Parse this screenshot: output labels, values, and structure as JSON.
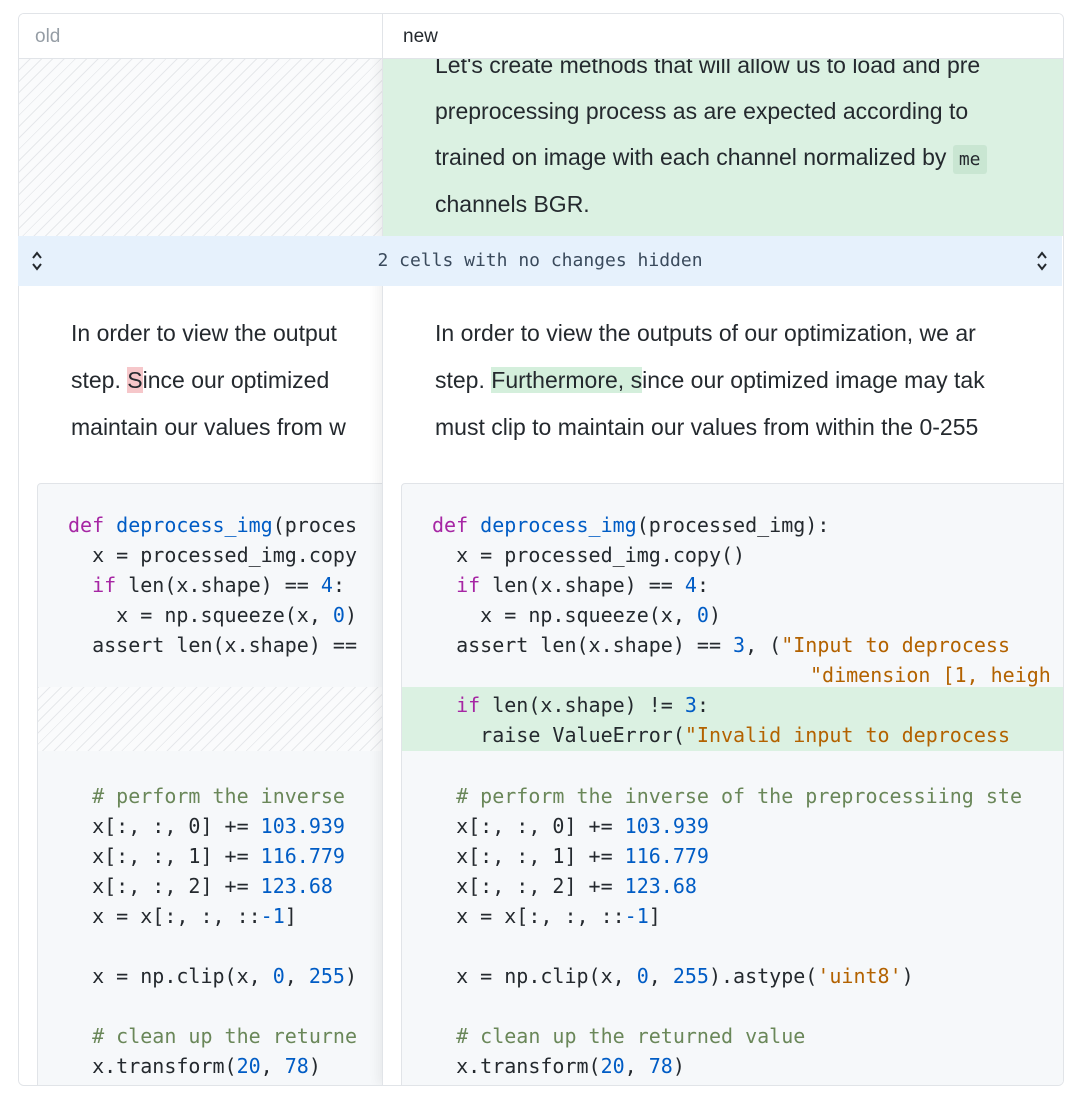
{
  "header": {
    "old_label": "old",
    "new_label": "new"
  },
  "new_markdown": {
    "line1": "Let's create methods that will allow us to load and pre",
    "line2": "preprocessing process as are expected according to",
    "line3_pre": "trained on image with each channel normalized by",
    "line3_code": "me",
    "line4": "channels BGR."
  },
  "hidden_band": {
    "text": "2 cells with no changes hidden",
    "icon": "unfold-icon"
  },
  "old_para": {
    "l1": "In order to view the output",
    "l2_pre": "step. ",
    "l2_del": "S",
    "l2_post": "ince our optimized",
    "l3": "maintain our values from w"
  },
  "new_para": {
    "l1": "In order to view the outputs of our optimization, we ar",
    "l2_pre": "step. ",
    "l2_add": "Furthermore, s",
    "l2_post": "ince our optimized image may tak",
    "l3": "must clip to maintain our values from within the 0-255"
  },
  "old_code": {
    "l1_kw": "def",
    "l1_fn": "deprocess_img",
    "l1_rest": "(proces",
    "l2": "  x = processed_img.copy",
    "l3_kw": "if",
    "l3_a": " len(x.shape) == ",
    "l3_n": "4",
    "l3_b": ":",
    "l4_a": "    x = np.squeeze(x, ",
    "l4_n": "0",
    "l4_b": ")",
    "l5": "  assert len(x.shape) ==",
    "l6": "  # perform the inverse",
    "l7_a": "  x[:, :, 0] += ",
    "l7_n": "103.939",
    "l8_a": "  x[:, :, 1] += ",
    "l8_n": "116.779",
    "l9_a": "  x[:, :, 2] += ",
    "l9_n": "123.68",
    "l10_a": "  x = x[:, :, ::",
    "l10_n": "-1",
    "l10_b": "]",
    "l11_a": "  x = np.clip(x, ",
    "l11_n1": "0",
    "l11_m": ", ",
    "l11_n2": "255",
    "l11_b": ")",
    "l12": "  # clean up the returne",
    "l13_a": "  x.transform(",
    "l13_n1": "20",
    "l13_m": ", ",
    "l13_n2": "78",
    "l13_b": ")"
  },
  "new_code": {
    "l1_kw": "def",
    "l1_fn": "deprocess_img",
    "l1_rest": "(processed_img):",
    "l2": "  x = processed_img.copy()",
    "l3_kw": "if",
    "l3_a": " len(x.shape) == ",
    "l3_n": "4",
    "l3_b": ":",
    "l4_a": "    x = np.squeeze(x, ",
    "l4_n": "0",
    "l4_b": ")",
    "l5_a": "  assert len(x.shape) == ",
    "l5_n": "3",
    "l5_b": ", (",
    "l5_s": "\"Input to deprocess",
    "l6_s": "\"dimension [1, heigh",
    "l7_kw": "if",
    "l7_a": " len(x.shape) != ",
    "l7_n": "3",
    "l7_b": ":",
    "l8_a": "    raise ValueError(",
    "l8_s": "\"Invalid input to deprocess",
    "l9": "  # perform the inverse of the preprocessiing ste",
    "l10_a": "  x[:, :, 0] += ",
    "l10_n": "103.939",
    "l11_a": "  x[:, :, 1] += ",
    "l11_n": "116.779",
    "l12_a": "  x[:, :, 2] += ",
    "l12_n": "123.68",
    "l13_a": "  x = x[:, :, ::",
    "l13_n": "-1",
    "l13_b": "]",
    "l14_a": "  x = np.clip(x, ",
    "l14_n1": "0",
    "l14_m": ", ",
    "l14_n2": "255",
    "l14_b": ").astype(",
    "l14_s": "'uint8'",
    "l14_c": ")",
    "l15": "  # clean up the returned value",
    "l16_a": "  x.transform(",
    "l16_n1": "20",
    "l16_m": ", ",
    "l16_n2": "78",
    "l16_b": ")"
  }
}
